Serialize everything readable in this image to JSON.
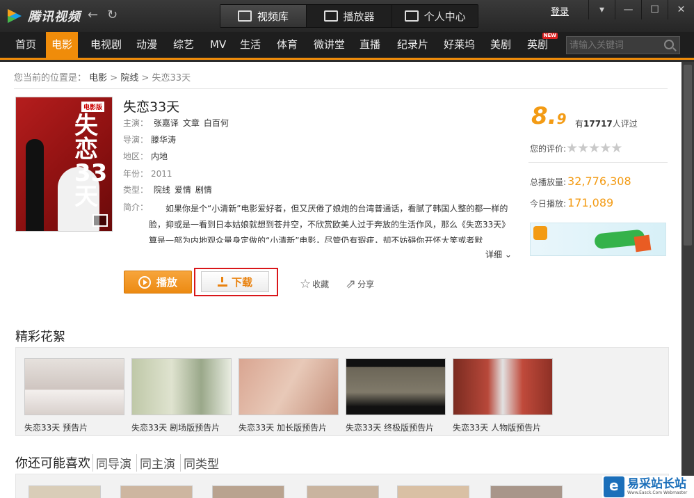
{
  "app": {
    "name": "腾讯视频"
  },
  "header": {
    "tabs": [
      {
        "label": "视频库",
        "icon": "film-icon"
      },
      {
        "label": "播放器",
        "icon": "play-icon"
      },
      {
        "label": "个人中心",
        "icon": "user-icon"
      }
    ],
    "login": "登录"
  },
  "nav": {
    "items": [
      "首页",
      "电影",
      "电视剧",
      "动漫",
      "综艺",
      "MV",
      "生活",
      "体育",
      "微讲堂",
      "直播",
      "纪录片",
      "好莱坞",
      "美剧",
      "英剧"
    ],
    "active": "电影",
    "new_badge": "NEW",
    "search_placeholder": "请输入关键词"
  },
  "breadcrumb": {
    "prefix": "您当前的位置是：",
    "items": [
      "电影",
      "院线",
      "失恋33天"
    ]
  },
  "movie": {
    "title": "失恋33天",
    "poster_badge": "电影版",
    "poster_title": "失恋33天",
    "cast_label": "主演：",
    "cast": [
      "张嘉译",
      "文章",
      "白百何"
    ],
    "director_label": "导演：",
    "director": "滕华涛",
    "region_label": "地区：",
    "region": "内地",
    "year_label": "年份：",
    "year": "2011",
    "genre_label": "类型：",
    "genres": [
      "院线",
      "爱情",
      "剧情"
    ],
    "synopsis_label": "简介：",
    "synopsis": "如果你是个“小清新”电影爱好者，但又厌倦了娘炮的台湾普通话，看腻了韩国人整的都一样的脸，抑或是一看到日本姑娘就想到苍井空，不欣赏欧美人过于奔放的生活作风，那么《失恋33天》算是一部为内地观众量身定做的“小清新”电影，尽管仍有瑕疵，却不妨碍你开怀大笑或者默",
    "detail": "详细",
    "play": "播放",
    "download": "下载",
    "favorite": "收藏",
    "share": "分享"
  },
  "rating": {
    "score_int": "8.",
    "score_dec": "9",
    "count_prefix": "有",
    "count": "17717",
    "count_suffix": "人评过",
    "my_rating_label": "您的评价:",
    "stars": [
      "★",
      "★",
      "★",
      "★",
      "★"
    ],
    "total_label": "总播放量:",
    "total": "32,776,308",
    "today_label": "今日播放:",
    "today": "171,089"
  },
  "highlights": {
    "title": "精彩花絮",
    "clips": [
      {
        "caption": "失恋33天  预告片"
      },
      {
        "caption": "失恋33天  剧场版预告片"
      },
      {
        "caption": "失恋33天  加长版预告片"
      },
      {
        "caption": "失恋33天  终极版预告片"
      },
      {
        "caption": "失恋33天  人物版预告片"
      }
    ]
  },
  "recommend": {
    "title": "你还可能喜欢",
    "tabs": [
      "同导演",
      "同主演",
      "同类型"
    ]
  },
  "watermark": {
    "name": "易采站长站",
    "sub": "Www.Easck.Com Webmaster"
  },
  "colors": {
    "accent": "#f08c0a",
    "rating": "#f39b14",
    "highlight_frame": "#d9161a"
  }
}
